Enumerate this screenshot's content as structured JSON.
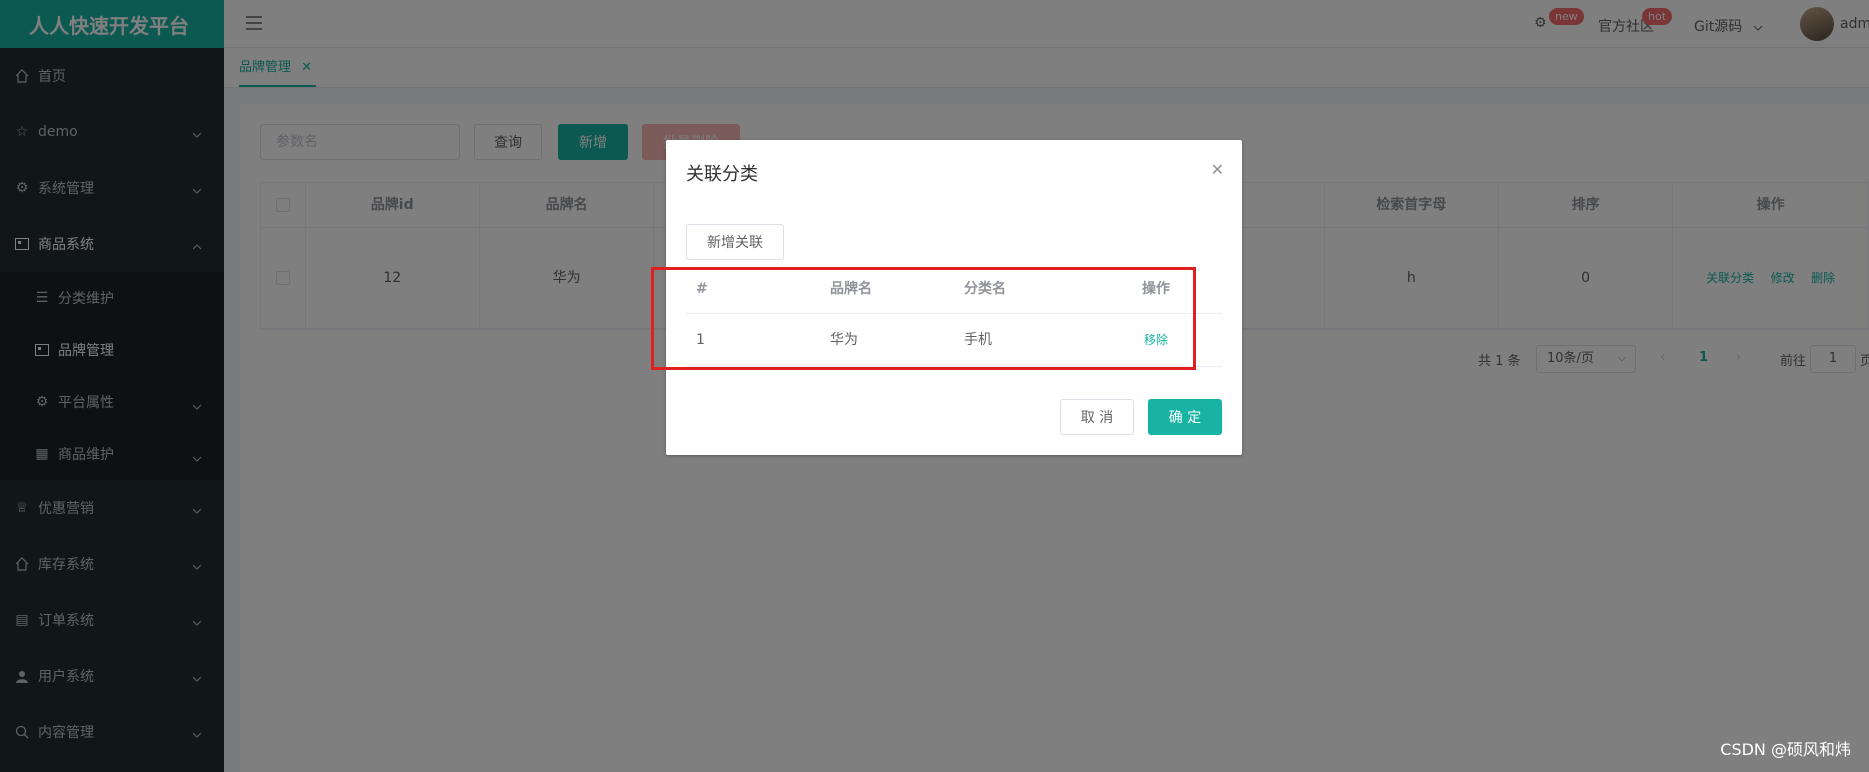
{
  "app": {
    "title": "人人快速开发平台"
  },
  "header": {
    "settings_badge": "new",
    "community_label": "官方社区",
    "community_badge": "hot",
    "git_label": "Git源码",
    "user_name": "adm"
  },
  "sidebar": {
    "items": [
      {
        "label": "首页",
        "icon": "home-icon"
      },
      {
        "label": "demo",
        "icon": "star-icon"
      },
      {
        "label": "系统管理",
        "icon": "gear-icon"
      },
      {
        "label": "商品系统",
        "icon": "product-icon"
      },
      {
        "label": "分类维护",
        "icon": "list-icon"
      },
      {
        "label": "品牌管理",
        "icon": "brand-icon"
      },
      {
        "label": "平台属性",
        "icon": "gear-icon"
      },
      {
        "label": "商品维护",
        "icon": "grid-icon"
      },
      {
        "label": "优惠营销",
        "icon": "trophy-icon"
      },
      {
        "label": "库存系统",
        "icon": "home-icon"
      },
      {
        "label": "订单系统",
        "icon": "doc-icon"
      },
      {
        "label": "用户系统",
        "icon": "user-icon"
      },
      {
        "label": "内容管理",
        "icon": "search-icon"
      }
    ]
  },
  "tabs": [
    {
      "label": "品牌管理"
    }
  ],
  "toolbar": {
    "search_placeholder": "参数名",
    "query_label": "查询",
    "add_label": "新增",
    "batch_delete_label": "批量删除"
  },
  "table": {
    "headers": [
      "品牌id",
      "品牌名",
      "检索首字母",
      "排序",
      "操作"
    ],
    "rows": [
      {
        "id": "12",
        "name": "华为",
        "first_letter": "h",
        "sort": "0"
      }
    ],
    "actions": [
      "关联分类",
      "修改",
      "删除"
    ]
  },
  "pager": {
    "total": "共 1 条",
    "page_size": "10条/页",
    "current": "1",
    "goto_label": "前往",
    "goto_value": "1",
    "page_suffix": "页"
  },
  "dialog": {
    "title": "关联分类",
    "add_relation_label": "新增关联",
    "headers": [
      "#",
      "品牌名",
      "分类名",
      "操作"
    ],
    "rows": [
      {
        "index": "1",
        "brand": "华为",
        "category": "手机",
        "action": "移除"
      }
    ],
    "cancel_label": "取 消",
    "confirm_label": "确 定"
  },
  "watermark": "CSDN @硕风和炜",
  "colors": {
    "primary": "#17b3a3",
    "sidebar": "#222d32",
    "highlight": "#e02020"
  }
}
